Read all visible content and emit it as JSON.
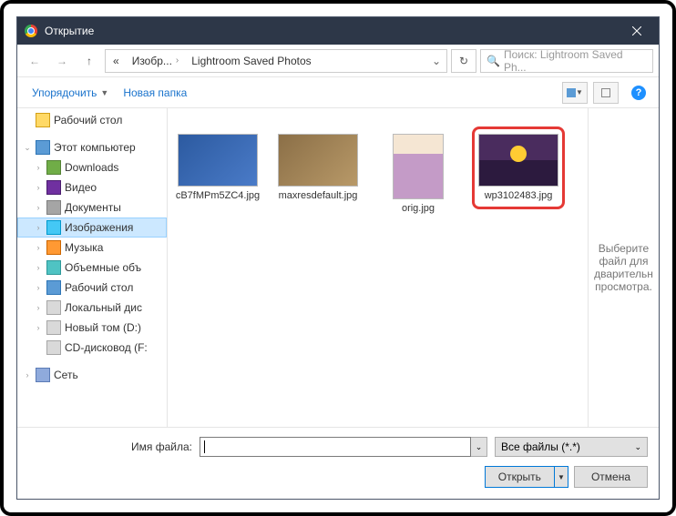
{
  "title": "Открытие",
  "nav": {
    "path_seg1": "Изобр...",
    "path_seg2": "Lightroom Saved Photos",
    "search_placeholder": "Поиск: Lightroom Saved Ph..."
  },
  "toolbar": {
    "organize": "Упорядочить",
    "new_folder": "Новая папка"
  },
  "tree": {
    "desktop": "Рабочий стол",
    "this_pc": "Этот компьютер",
    "downloads": "Downloads",
    "videos": "Видео",
    "documents": "Документы",
    "images": "Изображения",
    "music": "Музыка",
    "objects3d": "Объемные объ",
    "desktop2": "Рабочий стол",
    "local_disk": "Локальный дис",
    "new_volume": "Новый том (D:)",
    "cd_drive": "CD-дисковод (F:",
    "network": "Сеть"
  },
  "files": [
    {
      "name": "cB7fMPm5ZC4.jpg"
    },
    {
      "name": "maxresdefault.jpg"
    },
    {
      "name": "orig.jpg"
    },
    {
      "name": "wp3102483.jpg"
    }
  ],
  "preview_hint": "Выберите файл для дварительн просмотра.",
  "footer": {
    "filename_label": "Имя файла:",
    "filter": "Все файлы (*.*)",
    "open": "Открыть",
    "cancel": "Отмена"
  }
}
